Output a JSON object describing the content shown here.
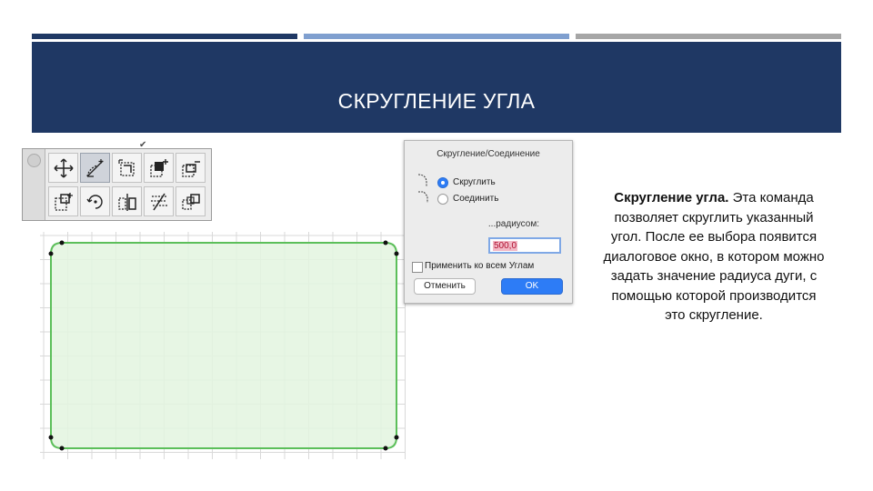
{
  "slide": {
    "title": "СКРУГЛЕНИЕ УГЛА",
    "colors": {
      "header": "#1f3864",
      "bar_dark": "#1f3864",
      "bar_light": "#7f9fcf",
      "bar_gray": "#a6a6a6",
      "fill": "#e3f5df",
      "stroke": "#5cbf5a"
    }
  },
  "toolbar": {
    "icons": [
      "move-icon",
      "fillet-icon",
      "offset-edge-icon",
      "add-vertex-icon",
      "subtract-vertex-icon",
      "stretch-icon",
      "rotate-icon",
      "mirror-icon",
      "split-icon",
      "multiply-icon"
    ],
    "active_index": 1
  },
  "dialog": {
    "title": "Скругление/Соединение",
    "option_round": "Скруглить",
    "option_join": "Соединить",
    "radius_label": "...радиусом:",
    "radius_value": "500,0",
    "apply_all_label": "Применить ко всем Углам",
    "cancel_label": "Отменить",
    "ok_label": "OK"
  },
  "description": {
    "bold": "Скругление угла.",
    "text": " Эта команда позволяет скруглить указанный угол. После ее выбора появится диалоговое окно, в котором  можно задать значение радиуса дуги, с помощью которой производится это скругление."
  }
}
